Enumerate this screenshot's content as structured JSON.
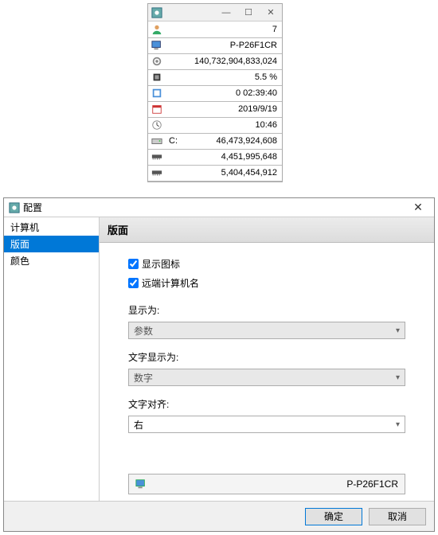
{
  "mini": {
    "rows": [
      {
        "icon": "person-icon",
        "label": "",
        "value": "7"
      },
      {
        "icon": "monitor-icon",
        "label": "",
        "value": "P-P26F1CR"
      },
      {
        "icon": "gear-icon",
        "label": "",
        "value": "140,732,904,833,024"
      },
      {
        "icon": "cpu-icon",
        "label": "",
        "value": "5.5 %"
      },
      {
        "icon": "clock-icon",
        "label": "",
        "value": "0   02:39:40"
      },
      {
        "icon": "calendar-icon",
        "label": "",
        "value": "2019/9/19"
      },
      {
        "icon": "time-icon",
        "label": "",
        "value": "10:46"
      },
      {
        "icon": "disk-icon",
        "label": "C:",
        "value": "46,473,924,608"
      },
      {
        "icon": "ram-icon",
        "label": "",
        "value": "4,451,995,648"
      },
      {
        "icon": "ram-icon",
        "label": "",
        "value": "5,404,454,912"
      }
    ]
  },
  "dialog": {
    "title": "配置",
    "sidebar": {
      "items": [
        {
          "label": "计算机",
          "selected": false
        },
        {
          "label": "版面",
          "selected": true
        },
        {
          "label": "颜色",
          "selected": false
        }
      ]
    },
    "panel": {
      "header": "版面",
      "checkbox_show_icons": "显示图标",
      "checkbox_remote_name": "远端计算机名",
      "label_show_as": "显示为:",
      "combo_show_as": "参数",
      "label_text_as": "文字显示为:",
      "combo_text_as": "数字",
      "label_align": "文字对齐:",
      "combo_align": "右",
      "preview_text": "P-P26F1CR"
    },
    "buttons": {
      "ok": "确定",
      "cancel": "取消"
    }
  }
}
